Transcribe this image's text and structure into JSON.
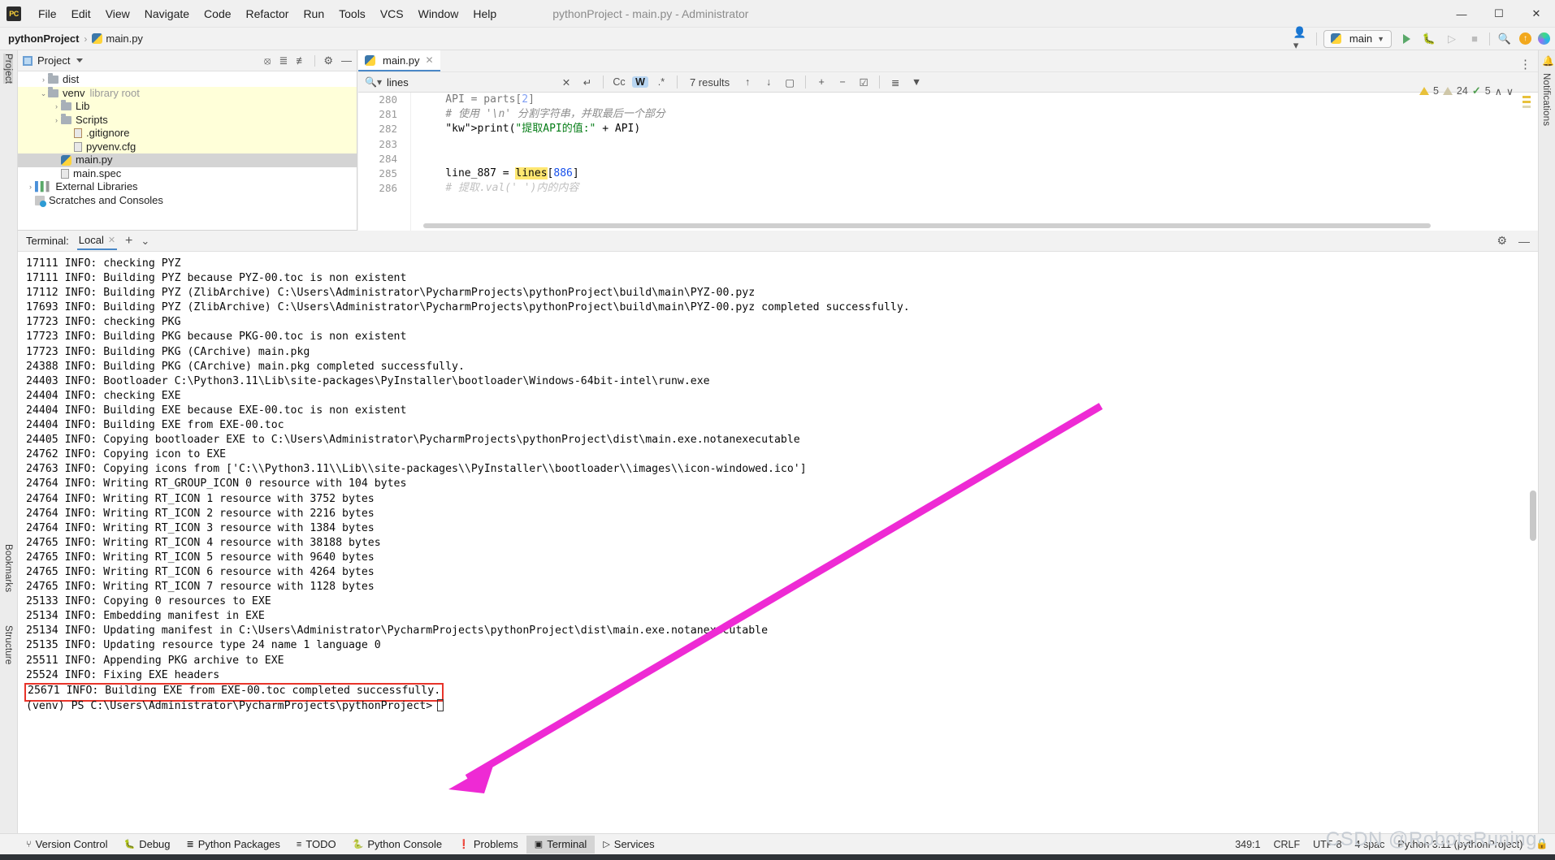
{
  "window": {
    "title": "pythonProject - main.py - Administrator",
    "logo": "pycharm-logo",
    "menus": [
      "File",
      "Edit",
      "View",
      "Navigate",
      "Code",
      "Refactor",
      "Run",
      "Tools",
      "VCS",
      "Window",
      "Help"
    ],
    "controls": {
      "minimize": "—",
      "maximize": "☐",
      "close": "✕"
    }
  },
  "navbar": {
    "breadcrumb": {
      "project": "pythonProject",
      "separator": "›",
      "file": "main.py"
    },
    "run_config": "main",
    "icons": [
      "user-avatar-icon",
      "run-icon",
      "debug-icon",
      "coverage-icon",
      "stop-icon",
      "search-everywhere-icon",
      "update-icon",
      "ide-features-icon"
    ]
  },
  "left_strip": {
    "top_label": "Project",
    "mid_label": "Bookmarks",
    "bottom_label": "Structure"
  },
  "right_strip": {
    "label": "Notifications"
  },
  "project_panel": {
    "title": "Project",
    "tree": [
      {
        "indent": 1,
        "arrow": "›",
        "icon": "folder-icon",
        "label": "dist",
        "tag": "",
        "style": ""
      },
      {
        "indent": 1,
        "arrow": "⌄",
        "icon": "folder-icon",
        "label": "venv",
        "tag": "library root",
        "style": "hl"
      },
      {
        "indent": 2,
        "arrow": "›",
        "icon": "folder-icon",
        "label": "Lib",
        "tag": "",
        "style": "hl"
      },
      {
        "indent": 2,
        "arrow": "›",
        "icon": "folder-icon",
        "label": "Scripts",
        "tag": "",
        "style": "hl"
      },
      {
        "indent": 3,
        "arrow": "",
        "icon": "gitignore-icon",
        "label": ".gitignore",
        "tag": "",
        "style": "hl"
      },
      {
        "indent": 3,
        "arrow": "",
        "icon": "file-icon",
        "label": "pyvenv.cfg",
        "tag": "",
        "style": "hl"
      },
      {
        "indent": 2,
        "arrow": "",
        "icon": "python-file-icon",
        "label": "main.py",
        "tag": "",
        "style": "sel"
      },
      {
        "indent": 2,
        "arrow": "",
        "icon": "file-icon",
        "label": "main.spec",
        "tag": "",
        "style": ""
      },
      {
        "indent": 0,
        "arrow": "›",
        "icon": "external-libraries-icon",
        "label": "External Libraries",
        "tag": "",
        "style": ""
      },
      {
        "indent": 0,
        "arrow": "",
        "icon": "scratches-icon",
        "label": "Scratches and Consoles",
        "tag": "",
        "style": ""
      }
    ]
  },
  "editor": {
    "tab": {
      "label": "main.py",
      "icon": "python-file-icon",
      "close": "✕"
    },
    "find": {
      "value": "lines",
      "placeholder": "Search",
      "clear": "✕",
      "history": "↵",
      "match_case": "Cc",
      "words": "W",
      "regex": ".*",
      "results": "7 results",
      "prev": "↑",
      "next": "↓",
      "select_all": "▢",
      "add_line": "+",
      "remove_line": "−",
      "toggle": "☑",
      "filter_list": "≣",
      "filter": "filter-icon"
    },
    "lines": [
      {
        "num": "280",
        "html": "    API = parts[2]",
        "faded": true
      },
      {
        "num": "281",
        "html": "    # 使用 '\\n' 分割字符串，并取最后一个部分"
      },
      {
        "num": "282",
        "html": "    print(\"提取API的值:\" + API)"
      },
      {
        "num": "283",
        "html": ""
      },
      {
        "num": "284",
        "html": ""
      },
      {
        "num": "285",
        "html": "    line_887 = lines[886]"
      },
      {
        "num": "286",
        "html": "    # 提取.val(' ')内的内容",
        "faded": true
      }
    ],
    "inspections": {
      "warnings": "5",
      "weak_warnings": "24",
      "typos": "5",
      "up": "∧",
      "down": "∨"
    }
  },
  "terminal": {
    "label": "Terminal:",
    "tab": "Local",
    "tab_close": "✕",
    "add": "+",
    "dropdown": "⌄",
    "settings_icon": "gear-icon",
    "hide_icon": "minimize-icon",
    "lines": [
      "17111 INFO: checking PYZ",
      "17111 INFO: Building PYZ because PYZ-00.toc is non existent",
      "17112 INFO: Building PYZ (ZlibArchive) C:\\Users\\Administrator\\PycharmProjects\\pythonProject\\build\\main\\PYZ-00.pyz",
      "17693 INFO: Building PYZ (ZlibArchive) C:\\Users\\Administrator\\PycharmProjects\\pythonProject\\build\\main\\PYZ-00.pyz completed successfully.",
      "17723 INFO: checking PKG",
      "17723 INFO: Building PKG because PKG-00.toc is non existent",
      "17723 INFO: Building PKG (CArchive) main.pkg",
      "24388 INFO: Building PKG (CArchive) main.pkg completed successfully.",
      "24403 INFO: Bootloader C:\\Python3.11\\Lib\\site-packages\\PyInstaller\\bootloader\\Windows-64bit-intel\\runw.exe",
      "24404 INFO: checking EXE",
      "24404 INFO: Building EXE because EXE-00.toc is non existent",
      "24404 INFO: Building EXE from EXE-00.toc",
      "24405 INFO: Copying bootloader EXE to C:\\Users\\Administrator\\PycharmProjects\\pythonProject\\dist\\main.exe.notanexecutable",
      "24762 INFO: Copying icon to EXE",
      "24763 INFO: Copying icons from ['C:\\\\Python3.11\\\\Lib\\\\site-packages\\\\PyInstaller\\\\bootloader\\\\images\\\\icon-windowed.ico']",
      "24764 INFO: Writing RT_GROUP_ICON 0 resource with 104 bytes",
      "24764 INFO: Writing RT_ICON 1 resource with 3752 bytes",
      "24764 INFO: Writing RT_ICON 2 resource with 2216 bytes",
      "24764 INFO: Writing RT_ICON 3 resource with 1384 bytes",
      "24765 INFO: Writing RT_ICON 4 resource with 38188 bytes",
      "24765 INFO: Writing RT_ICON 5 resource with 9640 bytes",
      "24765 INFO: Writing RT_ICON 6 resource with 4264 bytes",
      "24765 INFO: Writing RT_ICON 7 resource with 1128 bytes",
      "25133 INFO: Copying 0 resources to EXE",
      "25134 INFO: Embedding manifest in EXE",
      "25134 INFO: Updating manifest in C:\\Users\\Administrator\\PycharmProjects\\pythonProject\\dist\\main.exe.notanexecutable",
      "25135 INFO: Updating resource type 24 name 1 language 0",
      "25511 INFO: Appending PKG archive to EXE",
      "25524 INFO: Fixing EXE headers"
    ],
    "highlighted_line": "25671 INFO: Building EXE from EXE-00.toc completed successfully.",
    "prompt": "(venv) PS C:\\Users\\Administrator\\PycharmProjects\\pythonProject>"
  },
  "annotation": {
    "box_color": "#e8342a",
    "arrow_color": "#ee2ad4"
  },
  "bottom_bar": {
    "items": [
      {
        "label": "Version Control",
        "icon": "branch-icon",
        "active": false
      },
      {
        "label": "Debug",
        "icon": "bug-icon",
        "active": false
      },
      {
        "label": "Python Packages",
        "icon": "packages-icon",
        "active": false
      },
      {
        "label": "TODO",
        "icon": "todo-icon",
        "active": false
      },
      {
        "label": "Python Console",
        "icon": "python-console-icon",
        "active": false
      },
      {
        "label": "Problems",
        "icon": "problems-icon",
        "active": false
      },
      {
        "label": "Terminal",
        "icon": "terminal-icon",
        "active": true
      },
      {
        "label": "Services",
        "icon": "services-icon",
        "active": false
      }
    ],
    "status": [
      "349:1",
      "CRLF",
      "UTF-8",
      "4 spac",
      "Python 3.11 (pythonProject)"
    ]
  },
  "watermark": "CSDN @RobotsRuning"
}
